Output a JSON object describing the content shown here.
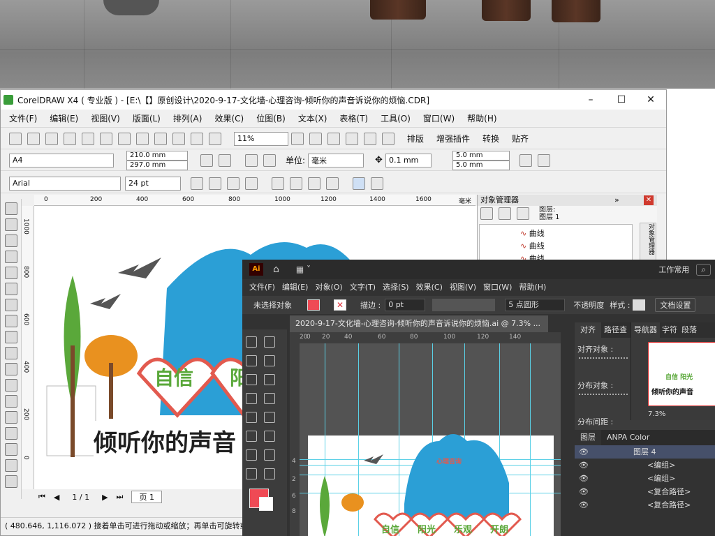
{
  "corel": {
    "title": "CorelDRAW X4 ( 专业版 ) - [E:\\【】原创设计\\2020-9-17-文化墙-心理咨询-倾听你的声音诉说你的烦恼.CDR]",
    "menu": [
      "文件(F)",
      "编辑(E)",
      "视图(V)",
      "版面(L)",
      "排列(A)",
      "效果(C)",
      "位图(B)",
      "文本(X)",
      "表格(T)",
      "工具(O)",
      "窗口(W)",
      "帮助(H)"
    ],
    "toolbar": {
      "zoom": "11%",
      "layout_btn": "排版",
      "plugin_btn": "增强插件",
      "convert_btn": "转换",
      "paste_btn": "贴齐"
    },
    "property": {
      "page_size": "A4",
      "width": "210.0 mm",
      "height": "297.0 mm",
      "unit_label": "单位:",
      "unit": "毫米",
      "nudge": "0.1 mm",
      "dup_x": "5.0 mm",
      "dup_y": "5.0 mm"
    },
    "text_bar": {
      "font": "Arial",
      "size": "24 pt"
    },
    "ruler_ticks": [
      "0",
      "200",
      "400",
      "600",
      "800",
      "1000",
      "1200",
      "1400",
      "1600"
    ],
    "ruler_unit": "毫米",
    "vruler_ticks": [
      "1000",
      "800",
      "600",
      "400",
      "200",
      "0"
    ],
    "page_nav": {
      "pages": "1 / 1",
      "tab": "页 1"
    },
    "status": "( 480.646, 1,116.072 ) 接着单击可进行拖动或缩放；再单击可旋转或倾",
    "design": {
      "slogan": "倾听你的声音",
      "word1": "自信",
      "word2": "阳"
    }
  },
  "object_manager": {
    "title": "对象管理器",
    "layer_header": "图层:",
    "layer_name": "图层 1",
    "items": [
      "曲线",
      "曲线",
      "曲线"
    ],
    "side_tab": "对象管理器"
  },
  "ai": {
    "workspace": "工作常用",
    "menu": [
      "文件(F)",
      "编辑(E)",
      "对象(O)",
      "文字(T)",
      "选择(S)",
      "效果(C)",
      "视图(V)",
      "窗口(W)",
      "帮助(H)"
    ],
    "control": {
      "no_selection": "未选择对象",
      "stroke_label": "描边 :",
      "stroke_value": "0 pt",
      "brush": "5 点圆形",
      "opacity_label": "不透明度",
      "style_label": "样式 :",
      "doc_setup": "文档设置"
    },
    "doc_tab": "2020-9-17-文化墙-心理咨询-倾听你的声音诉说你的烦恼.ai @ 7.3% ...",
    "ruler_ticks": [
      "20",
      "0",
      "20",
      "40",
      "60",
      "80",
      "100",
      "120",
      "140"
    ],
    "vruler_ticks": [
      "4",
      "2",
      "6",
      "8"
    ],
    "panels": {
      "align_tabs": [
        "对齐",
        "路径查"
      ],
      "align_to": "对齐对象 :",
      "distribute": "分布对象 :",
      "distribute_space": "分布间距 :",
      "nav_tabs": [
        "导航器",
        "字符",
        "段落"
      ],
      "nav_zoom": "7.3%",
      "layers_tabs": [
        "图层",
        "ANPA Color"
      ],
      "layers": [
        "图层 4",
        "<编组>",
        "<编组>",
        "<复合路径>",
        "<复合路径>"
      ]
    },
    "design": {
      "badge": "心理咨询",
      "words": [
        "自信",
        "阳光",
        "乐观",
        "开朗"
      ],
      "nav_words": "自信 阳光",
      "nav_slogan": "倾听你的声音"
    }
  },
  "colors": {
    "heart_blue": "#2b9fd6",
    "heart_red": "#e25a4f",
    "tree_green": "#5aa83a",
    "tree_orange": "#e9911f",
    "trunk": "#7a4a2a",
    "slogan_text": "#1f1f1f",
    "ai_bg": "#323232",
    "fill_swatch": "#ef4a55",
    "guide": "#5ad0e6"
  }
}
